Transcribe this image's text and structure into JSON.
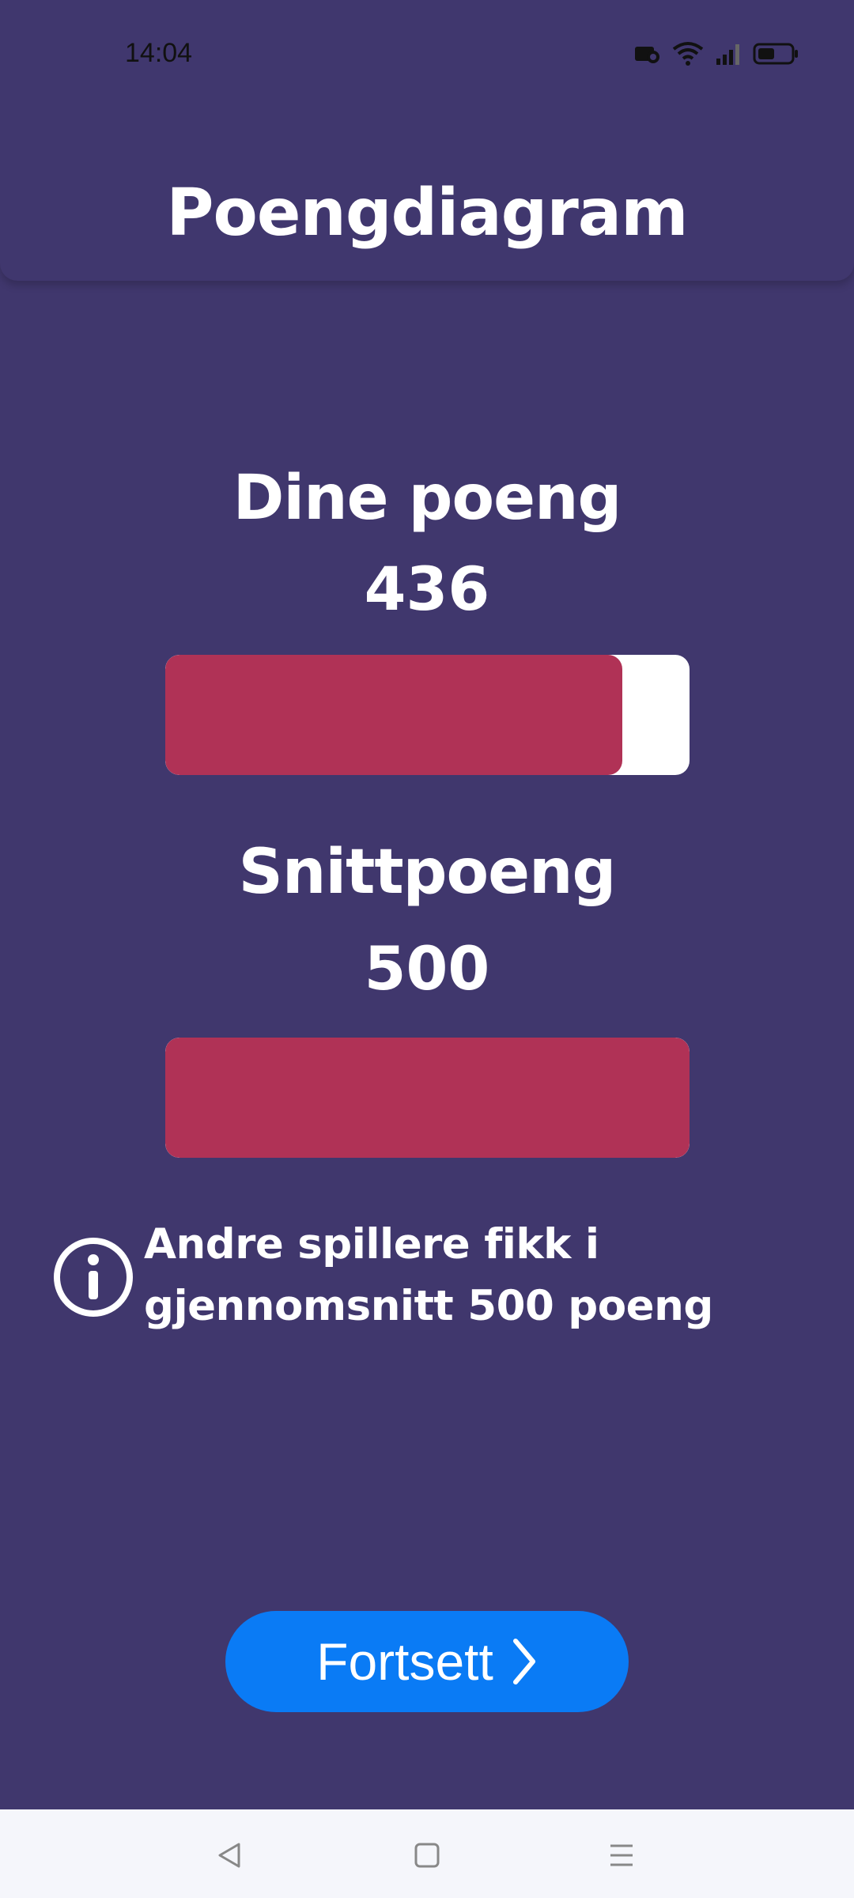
{
  "status_bar": {
    "time": "14:04",
    "icons": [
      "screen-record-icon",
      "wifi-icon",
      "signal-icon",
      "battery-icon"
    ]
  },
  "header": {
    "title": "Poengdiagram"
  },
  "scores": {
    "yours": {
      "label": "Dine poeng",
      "value": "436",
      "bar_fraction": 0.872
    },
    "average": {
      "label": "Snittpoeng",
      "value": "500",
      "bar_fraction": 1.0
    }
  },
  "info": {
    "icon": "info-icon",
    "text": "Andre spillere fikk i gjennomsnitt 500 poeng"
  },
  "actions": {
    "continue_label": "Fortsett",
    "continue_icon": "chevron-right-icon"
  },
  "navigation": {
    "buttons": [
      "back-icon",
      "home-icon",
      "menu-icon"
    ]
  },
  "colors": {
    "background": "#40376d",
    "bar_fill": "#b03256",
    "bar_track": "#ffffff",
    "button": "#0a7bf5",
    "text": "#ffffff"
  }
}
